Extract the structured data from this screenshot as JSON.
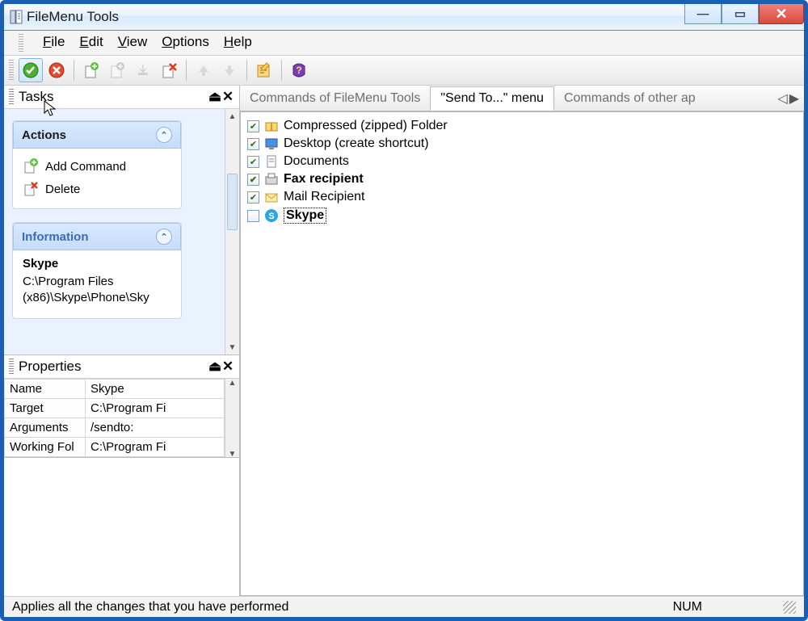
{
  "window": {
    "title": "FileMenu Tools"
  },
  "menu": {
    "file": "File",
    "edit": "Edit",
    "view": "View",
    "options": "Options",
    "help": "Help"
  },
  "toolbar": {
    "apply": "apply",
    "cancel": "cancel",
    "add": "add-command",
    "add2": "add-submenu",
    "add3": "add-separator",
    "delete": "delete",
    "up": "move-up",
    "down": "move-down",
    "options": "options",
    "help": "help"
  },
  "tasksPanel": {
    "title": "Tasks",
    "actions": {
      "heading": "Actions",
      "add": "Add Command",
      "delete": "Delete"
    },
    "info": {
      "heading": "Information",
      "name": "Skype",
      "path": "C:\\Program Files (x86)\\Skype\\Phone\\Sky"
    }
  },
  "propertiesPanel": {
    "title": "Properties",
    "rows": [
      {
        "k": "Name",
        "v": "Skype"
      },
      {
        "k": "Target",
        "v": "C:\\Program Fi"
      },
      {
        "k": "Arguments",
        "v": "/sendto:"
      },
      {
        "k": "Working Fol",
        "v": "C:\\Program Fi"
      }
    ]
  },
  "tabs": {
    "t1": "Commands of FileMenu Tools",
    "t2": "\"Send To...\" menu",
    "t3": "Commands of other ap"
  },
  "sendToItems": [
    {
      "checked": true,
      "icon": "zip",
      "label": "Compressed (zipped) Folder",
      "bold": false,
      "selected": false
    },
    {
      "checked": true,
      "icon": "desktop",
      "label": "Desktop (create shortcut)",
      "bold": false,
      "selected": false
    },
    {
      "checked": true,
      "icon": "doc",
      "label": "Documents",
      "bold": false,
      "selected": false
    },
    {
      "checked": true,
      "icon": "fax",
      "label": "Fax recipient",
      "bold": true,
      "selected": false
    },
    {
      "checked": true,
      "icon": "mail",
      "label": "Mail Recipient",
      "bold": false,
      "selected": false
    },
    {
      "checked": false,
      "icon": "skype",
      "label": "Skype",
      "bold": true,
      "selected": true
    }
  ],
  "status": {
    "text": "Applies all the changes that you have performed",
    "num": "NUM"
  }
}
